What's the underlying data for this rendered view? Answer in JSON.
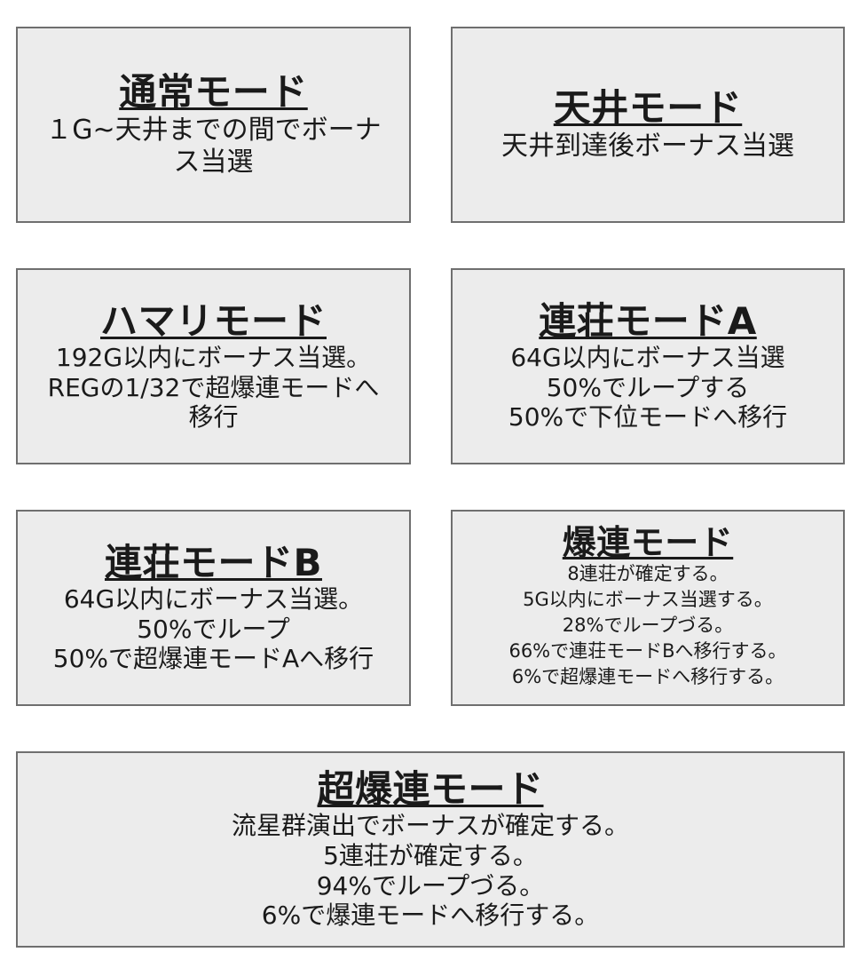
{
  "boxes": {
    "normal": {
      "title": "通常モード",
      "lines": [
        "１G~天井までの間でボーナス当選"
      ]
    },
    "tenjo": {
      "title": "天井モード",
      "lines": [
        "天井到達後ボーナス当選"
      ]
    },
    "hamari": {
      "title": "ハマリモード",
      "lines": [
        "192G以内にボーナス当選。REGの1/32で超爆連モードへ移行"
      ]
    },
    "renA": {
      "title": "連荘モードA",
      "lines": [
        "64G以内にボーナス当選",
        "50%でループする",
        "50%で下位モードへ移行"
      ]
    },
    "renB": {
      "title": "連荘モードB",
      "lines": [
        "64G以内にボーナス当選。",
        "50%でループ",
        "50%で超爆連モードAへ移行"
      ]
    },
    "bakuren": {
      "title": "爆連モード",
      "lines": [
        "8連荘が確定する。",
        "5G以内にボーナス当選する。",
        "28%でループづる。",
        "66%で連荘モードBへ移行する。",
        "6%で超爆連モードへ移行する。"
      ]
    },
    "super": {
      "title": "超爆連モード",
      "lines": [
        "流星群演出でボーナスが確定する。",
        "5連荘が確定する。",
        "94%でループづる。",
        "6%で爆連モードへ移行する。"
      ]
    }
  }
}
